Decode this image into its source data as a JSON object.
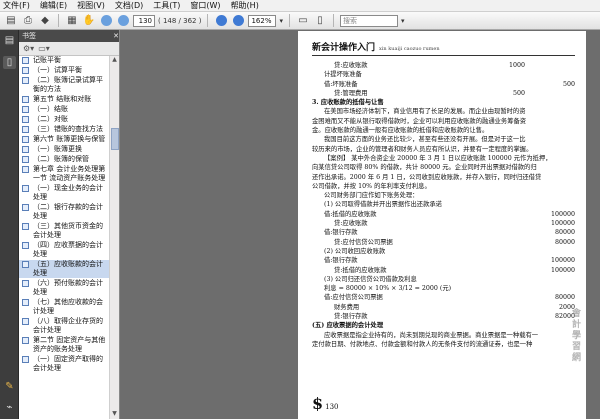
{
  "menu": [
    "文件(F)",
    "编辑(E)",
    "视图(V)",
    "文档(D)",
    "工具(T)",
    "窗口(W)",
    "帮助(H)"
  ],
  "toolbar": {
    "page_current": "130",
    "page_total": "( 148 / 362 )",
    "zoom": "162%",
    "search_placeholder": "搜索"
  },
  "panel": {
    "title": "书签",
    "close": "✕"
  },
  "bookmarks": [
    {
      "label": "记账平衡"
    },
    {
      "label": "（一）试算平衡"
    },
    {
      "label": "（二）账簿记录试算平衡的方法"
    },
    {
      "label": "第五节  结账和对账"
    },
    {
      "label": "（一）结账"
    },
    {
      "label": "（二）对账"
    },
    {
      "label": "（三）错账的查找方法"
    },
    {
      "label": "第六节  账簿更换与保管"
    },
    {
      "label": "（一）账簿更换"
    },
    {
      "label": "（二）账簿的保管"
    },
    {
      "label": "第七章  会计业务处理第一节  流动资产账务处理"
    },
    {
      "label": "（一）现金业务的会计处理"
    },
    {
      "label": "（二）银行存款的会计处理"
    },
    {
      "label": "（三）其他货币资金的会计处理"
    },
    {
      "label": "（四）应收票据的会计处理"
    },
    {
      "label": "（五）应收账款的会计处理",
      "selected": true
    },
    {
      "label": "（六）预付账款的会计处理"
    },
    {
      "label": "（七）其他应收款的会计处理"
    },
    {
      "label": "（八）取得企业存货的会计处理"
    },
    {
      "label": "第二节  固定资产与其他资产的账务处理"
    },
    {
      "label": "（一）固定资产取得的会计处理"
    }
  ],
  "page": {
    "header_title": "新会计操作入门",
    "header_sub": "xin kuaiji caozuo rumen",
    "page_number": "130",
    "dollar": "$",
    "watermark": "會計學習網",
    "lines_top": [
      {
        "l": "贷:应收账款",
        "v": "1000",
        "v2": "",
        "cls": "ind2"
      },
      {
        "l": "计提坏账准备",
        "v": "",
        "v2": "",
        "cls": "ind"
      },
      {
        "l": "借:坏账准备",
        "v": "",
        "v2": "500",
        "cls": "ind"
      },
      {
        "l": "贷:管理费用",
        "v": "500",
        "v2": "",
        "cls": "ind2"
      }
    ],
    "heading1": "3. 应收账款的抵借与让售",
    "para1": [
      "在美国市场经济体制下，商业信用有了长足的发展。而企业由现暂时的资",
      "金困难而又不能从银行取得借款时，企业可以利用应收账款的融通业务筹备资",
      "金。应收账款的融通一般有应收账款的抵借和应收账款的让售。",
      "我国目前这方面的业务还比较少，甚至有些还没有开展。但是对于这一比",
      "较历来的市场，企业的管理者和财务人员应有所认识，并要有一定程度的掌握。"
    ],
    "case": [
      "【案例】  某中外合资企业 20000 年 3 月 1 日以应收账款 100000 元作为抵押，",
      "向某信贷公司取得 80% 的借款，共计 80000 元。企业同时开出票据对借款的归",
      "还作出承诺。2000 年 6 月 1 日，公司收到应收账款，并存入银行，同时归还借贷",
      "公司借款，并按 10% 的年利率支付利息。"
    ],
    "intro": "公司财务部门应作如下账务处理：",
    "sub1": "(1) 公司取得借款并开出票据作出还款承诺",
    "entries1": [
      {
        "l": "借:抵借的应收账款",
        "v": "100000",
        "cls": "ind"
      },
      {
        "l": "贷:应收账款",
        "v": "100000",
        "cls": "ind2"
      },
      {
        "l": "借:银行存款",
        "v": "80000",
        "cls": "ind"
      },
      {
        "l": "贷:应付信贷公司票据",
        "v": "80000",
        "cls": "ind2"
      }
    ],
    "sub2": "(2) 公司收回应收账款",
    "entries2": [
      {
        "l": "借:银行存款",
        "v": "100000",
        "cls": "ind"
      },
      {
        "l": "贷:抵借的应收账款",
        "v": "100000",
        "cls": "ind2"
      }
    ],
    "sub3": "(3) 公司归还信贷公司借款及利息",
    "interest": "利息 = 80000 × 10% × 3/12 = 2000 (元)",
    "entries3": [
      {
        "l": "借:应付信贷公司票据",
        "v": "80000",
        "cls": "ind"
      },
      {
        "l": "财务费用",
        "v": "2000",
        "cls": "ind2"
      },
      {
        "l": "贷:银行存款",
        "v": "82000",
        "cls": "ind2"
      }
    ],
    "heading2": "(五) 应收票据的会计处理",
    "para2": [
      "应收票据是指企业持有的，尚未到期兑现的商业票据。商业票据是一种载有一",
      "定付款日期、付款地点、付款金额和付款人的无条件支付的流通证券，也是一种"
    ]
  }
}
